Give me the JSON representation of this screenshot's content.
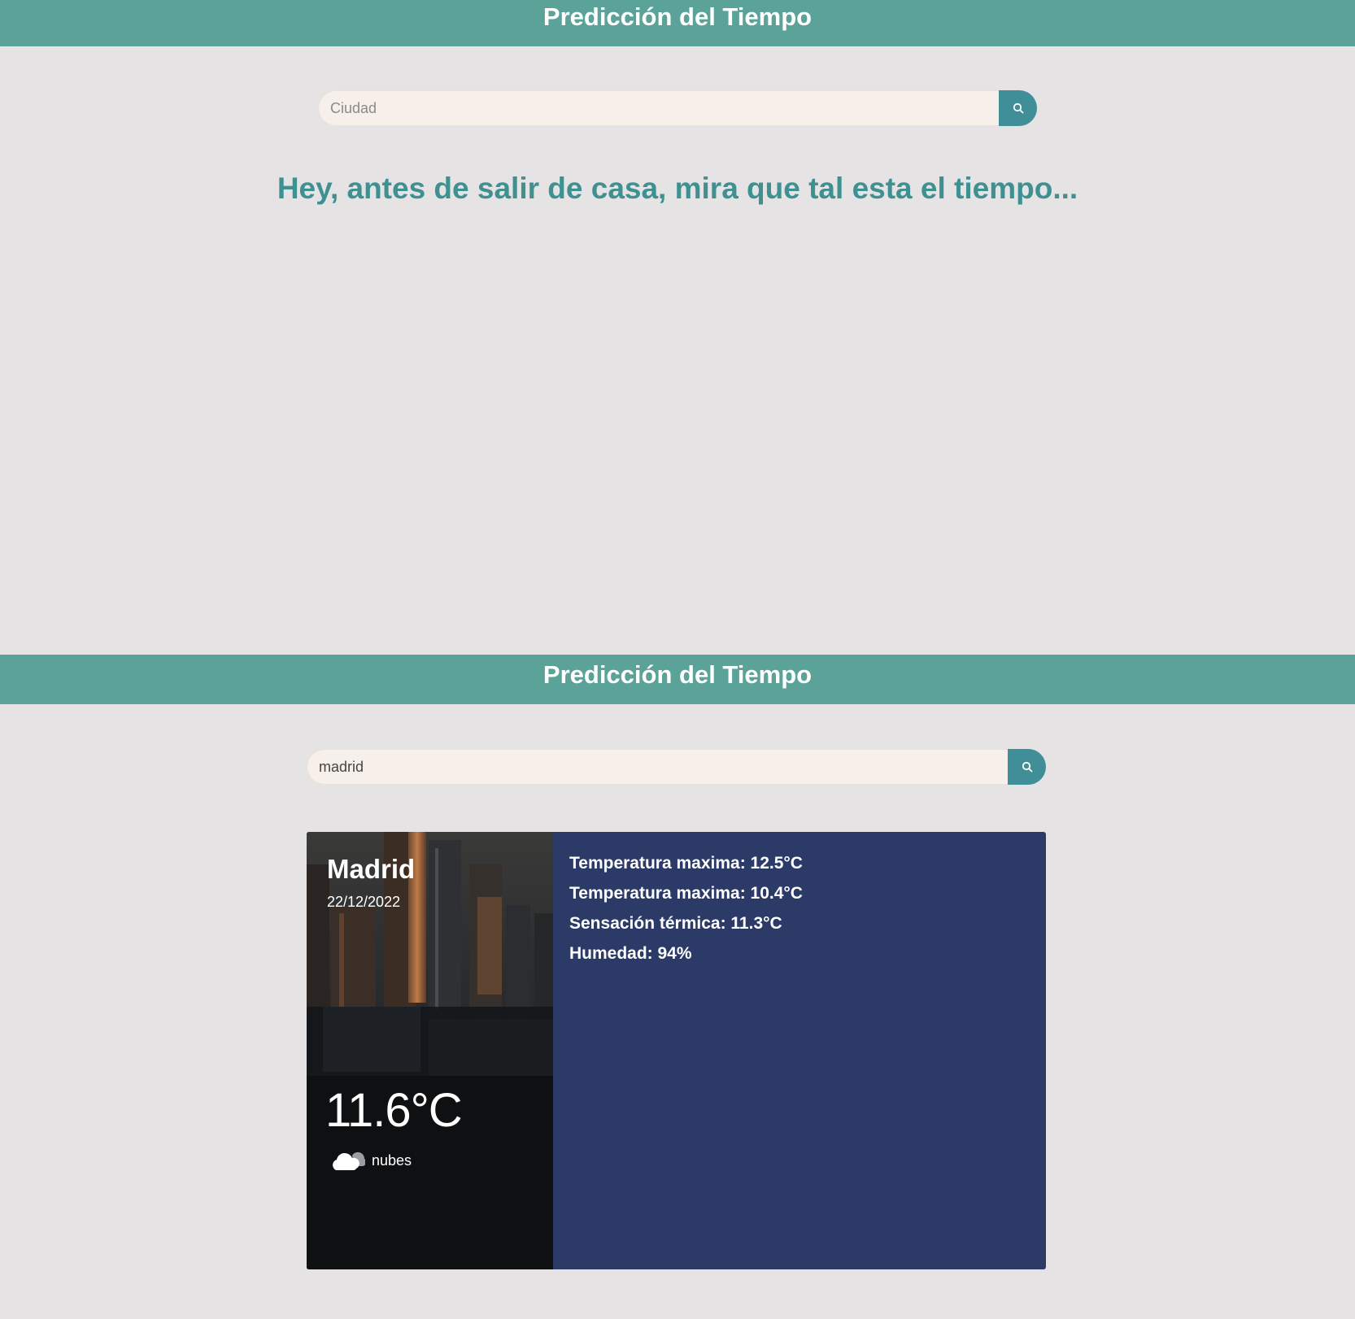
{
  "screens": [
    {
      "header": {
        "title": "Predicción del Tiempo"
      },
      "search": {
        "placeholder": "Ciudad",
        "value": ""
      },
      "tagline": "Hey, antes de salir de casa, mira que tal esta el tiempo..."
    },
    {
      "header": {
        "title": "Predicción del Tiempo"
      },
      "search": {
        "placeholder": "Ciudad",
        "value": "madrid"
      },
      "weather": {
        "city": "Madrid",
        "date": "22/12/2022",
        "temperature": "11.6°C",
        "condition": "nubes",
        "condition_icon": "cloud-icon",
        "details": [
          "Temperatura maxima: 12.5°C",
          "Temperatura maxima: 10.4°C",
          "Sensación térmica: 11.3°C",
          "Humedad: 94%"
        ]
      }
    }
  ],
  "colors": {
    "header": "#5ba298",
    "background": "#e5e3e4",
    "search_button": "#3f8e98",
    "tagline": "#3e9190",
    "details_panel": "#2c3a68"
  },
  "icons": {
    "search": "search-icon",
    "weather": "cloud-icon"
  }
}
